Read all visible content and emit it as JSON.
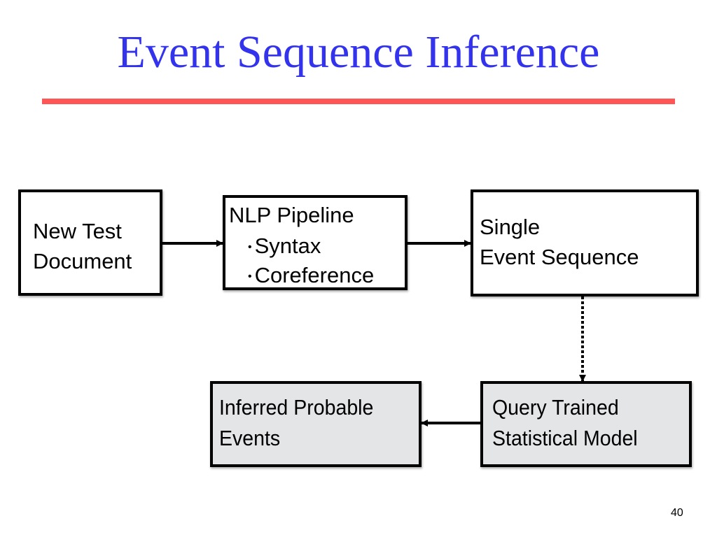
{
  "slide": {
    "title": "Event Sequence Inference",
    "page_number": "40",
    "colors": {
      "title": "#3333ee",
      "title_rule": "#ff5555",
      "box_border": "#000000",
      "box_fill": "#ffffff",
      "box_fill_gray": "#e3e5e6"
    }
  },
  "diagram": {
    "nodes": {
      "new_test_document": {
        "lines": [
          "New Test",
          "Document"
        ]
      },
      "nlp_pipeline": {
        "heading": "NLP Pipeline",
        "bullets": [
          "Syntax",
          "Coreference"
        ],
        "bullet_glyph": "•"
      },
      "single_event_sequence": {
        "lines": [
          "Single",
          "Event Sequence"
        ]
      },
      "query_model": {
        "lines": [
          "Query Trained",
          "Statistical Model"
        ]
      },
      "inferred_events": {
        "lines": [
          "Inferred Probable",
          "Events"
        ]
      }
    },
    "edges": [
      {
        "from": "new_test_document",
        "to": "nlp_pipeline",
        "style": "solid"
      },
      {
        "from": "nlp_pipeline",
        "to": "single_event_sequence",
        "style": "solid"
      },
      {
        "from": "single_event_sequence",
        "to": "query_model",
        "style": "dotted"
      },
      {
        "from": "query_model",
        "to": "inferred_events",
        "style": "solid"
      }
    ]
  }
}
